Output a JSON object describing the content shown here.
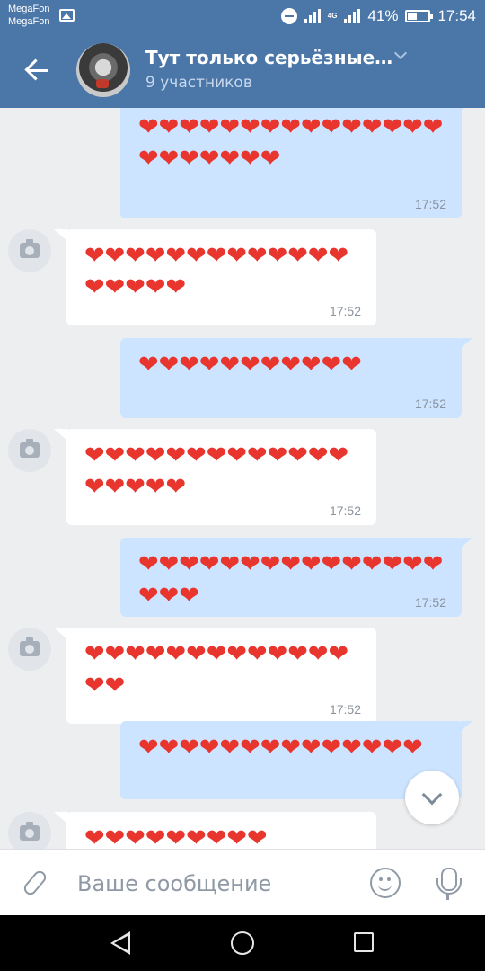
{
  "status_bar": {
    "carrier_1": "MegaFon",
    "carrier_2": "MegaFon",
    "network": "4G",
    "battery": "41%",
    "time": "17:54"
  },
  "header": {
    "title": "Тут только серьёзные…",
    "subtitle": "9 участников"
  },
  "messages": [
    {
      "direction": "out",
      "hearts": "❤❤❤❤❤❤❤❤❤❤❤❤❤❤❤❤❤❤❤❤❤❤",
      "time": "17:52"
    },
    {
      "direction": "in",
      "hearts": "❤❤❤❤❤❤❤❤❤❤❤❤❤❤❤❤❤❤",
      "time": "17:52"
    },
    {
      "direction": "out",
      "hearts": "❤❤❤❤❤❤❤❤❤❤❤",
      "time": "17:52"
    },
    {
      "direction": "in",
      "hearts": "❤❤❤❤❤❤❤❤❤❤❤❤❤❤❤❤❤❤",
      "time": "17:52"
    },
    {
      "direction": "out",
      "hearts": "❤❤❤❤❤❤❤❤❤❤❤❤❤❤❤❤❤❤",
      "time": "17:52"
    },
    {
      "direction": "in",
      "hearts": "❤❤❤❤❤❤❤❤❤❤❤❤❤❤❤",
      "time": "17:52"
    },
    {
      "direction": "out",
      "hearts": "❤❤❤❤❤❤❤❤❤❤❤❤❤❤",
      "time": ""
    },
    {
      "direction": "in",
      "hearts": "❤❤❤❤❤❤❤❤❤",
      "time": ""
    }
  ],
  "composer": {
    "placeholder": "Ваше сообщение"
  },
  "colors": {
    "header": "#4a76a8",
    "outgoing_bubble": "#cce4ff",
    "incoming_bubble": "#ffffff",
    "heart": "#e8352e"
  },
  "icons": {
    "back": "arrow-left-icon",
    "scroll_down": "chevron-down-icon",
    "attach": "paperclip-icon",
    "emoji": "smile-icon",
    "voice": "microphone-icon",
    "sender_avatar": "camera-icon"
  }
}
